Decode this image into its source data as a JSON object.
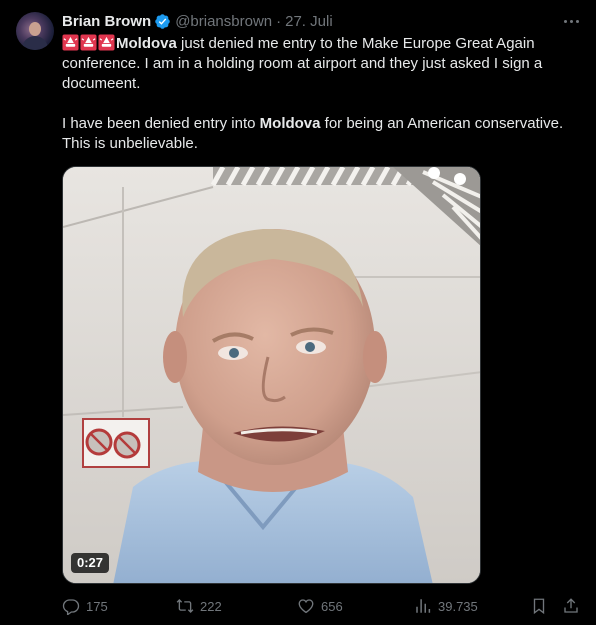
{
  "author": {
    "name": "Brian Brown",
    "handle": "@briansbrown",
    "separator": "·",
    "date": "27. Juli"
  },
  "tweet": {
    "p1_word": "Moldova",
    "p1_rest": " just denied me entry to the Make Europe Great Again conference. I am in a holding room at airport and they just asked I sign a documeent.",
    "p2_start": "I have been denied entry into ",
    "p2_word": "Moldova",
    "p2_rest": " for being an American conservative. This is unbelievable."
  },
  "media": {
    "duration": "0:27"
  },
  "stats": {
    "replies": "175",
    "retweets": "222",
    "likes": "656",
    "views": "39.735"
  },
  "colors": {
    "background": "#000000",
    "text": "#e7e9ea",
    "muted": "#71767b",
    "verified": "#1d9bf0",
    "alarm": "#e0364f"
  }
}
